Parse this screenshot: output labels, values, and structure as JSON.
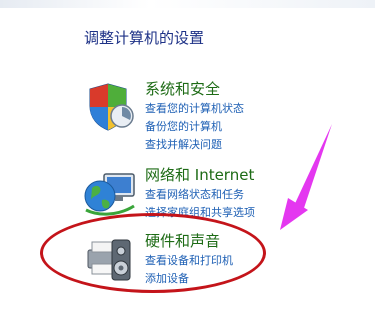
{
  "page": {
    "title": "调整计算机的设置"
  },
  "categories": [
    {
      "title": "系统和安全",
      "icon": "shield-security-icon",
      "links": [
        "查看您的计算机状态",
        "备份您的计算机",
        "查找并解决问题"
      ]
    },
    {
      "title": "网络和 Internet",
      "icon": "globe-network-icon",
      "links": [
        "查看网络状态和任务",
        "选择家庭组和共享选项"
      ]
    },
    {
      "title": "硬件和声音",
      "icon": "printer-speaker-icon",
      "links": [
        "查看设备和打印机",
        "添加设备"
      ]
    }
  ],
  "annotations": {
    "ellipse_color": "#c4141a",
    "arrow_color": "#e437f0"
  }
}
